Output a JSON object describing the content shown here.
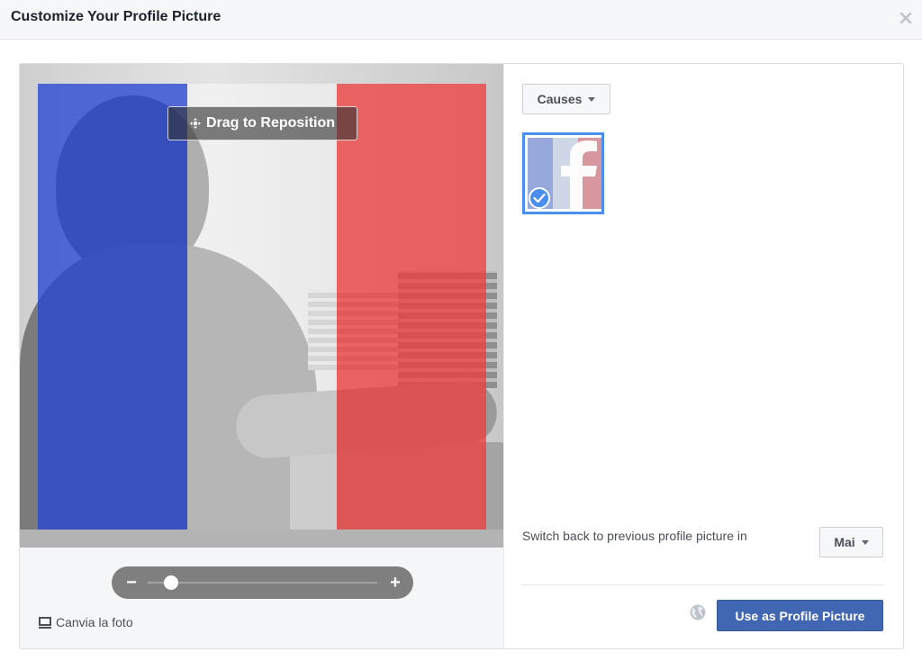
{
  "dialog": {
    "title": "Customize Your Profile Picture",
    "close_icon": "close-icon"
  },
  "editor": {
    "drag_label": "Drag to Reposition",
    "drag_icon": "move-arrows-icon",
    "zoom": {
      "minus_label": "−",
      "plus_label": "+",
      "value_fraction": 0.1
    },
    "change_photo_label": "Canvia la foto",
    "change_photo_icon": "photo-icon",
    "overlay_colors": {
      "blue": "#2846d2",
      "white": "#ffffff",
      "red": "#f03c3c"
    }
  },
  "options": {
    "category_dropdown": {
      "selected": "Causes"
    },
    "frames": [
      {
        "name": "France flag frame",
        "selected": true
      }
    ],
    "switch_back_label": "Switch back to previous profile picture in",
    "switch_back_dropdown": {
      "selected": "Mai"
    },
    "privacy_icon": "globe-icon",
    "submit_label": "Use as Profile Picture"
  },
  "colors": {
    "primary_button": "#4267b2",
    "selection_border": "#4a8ef0"
  }
}
